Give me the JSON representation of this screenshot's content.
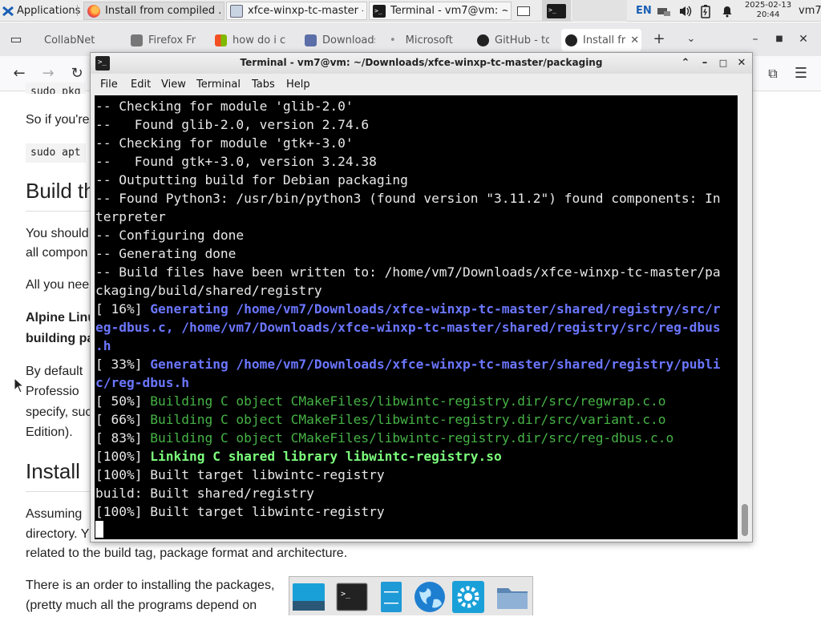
{
  "top_panel": {
    "applications_label": "Applications",
    "tasks": [
      {
        "label": "Install from compiled ...",
        "icon": "firefox-icon"
      },
      {
        "label": "xfce-winxp-tc-master -...",
        "icon": "folder-icon"
      },
      {
        "label": "Terminal - vm7@vm: ~...",
        "icon": "terminal-icon"
      }
    ],
    "keyboard_layout": "EN",
    "date": "2025-02-13",
    "time": "20:44",
    "user": "vm7"
  },
  "browser": {
    "tabs": [
      {
        "label": "CollabNet"
      },
      {
        "label": "Firefox Fr"
      },
      {
        "label": "how do i c"
      },
      {
        "label": "Downloads"
      },
      {
        "label": "Microsoft"
      },
      {
        "label": "GitHub - tc"
      },
      {
        "label": "Install fr"
      }
    ],
    "new_tab_symbol": "+",
    "page": {
      "cut_code": "sudo pkg",
      "p_if": "So if you're",
      "code_apt": "sudo apt",
      "h_build": "Build th",
      "p_should1": "You should",
      "p_should2": "all compon",
      "p_all": "All you nee",
      "p_alpine1": "Alpine Linu",
      "p_alpine2": "building pa",
      "p_default1": "By default",
      "p_default2": "Professio",
      "p_default3": "specify, suc",
      "p_default4": "Edition).",
      "h_install": "Install",
      "p_assuming": "Assuming",
      "p_directory": "directory. Y",
      "p_related": "related to the build tag, package format and architecture.",
      "p_order1": "There is an order to installing the packages,",
      "p_order2": "(pretty much all the programs depend on"
    }
  },
  "terminal": {
    "title": "Terminal - vm7@vm: ~/Downloads/xfce-winxp-tc-master/packaging",
    "menu": [
      "File",
      "Edit",
      "View",
      "Terminal",
      "Tabs",
      "Help"
    ],
    "lines": [
      {
        "parts": [
          {
            "t": "-- Checking for module 'glib-2.0'",
            "c": ""
          }
        ]
      },
      {
        "parts": [
          {
            "t": "--   Found glib-2.0, version 2.74.6",
            "c": ""
          }
        ]
      },
      {
        "parts": [
          {
            "t": "-- Checking for module 'gtk+-3.0'",
            "c": ""
          }
        ]
      },
      {
        "parts": [
          {
            "t": "--   Found gtk+-3.0, version 3.24.38",
            "c": ""
          }
        ]
      },
      {
        "parts": [
          {
            "t": "-- Outputting build for Debian packaging",
            "c": ""
          }
        ]
      },
      {
        "parts": [
          {
            "t": "-- Found Python3: /usr/bin/python3 (found version \"3.11.2\") found components: In",
            "c": ""
          }
        ]
      },
      {
        "parts": [
          {
            "t": "terpreter",
            "c": ""
          }
        ]
      },
      {
        "parts": [
          {
            "t": "-- Configuring done",
            "c": ""
          }
        ]
      },
      {
        "parts": [
          {
            "t": "-- Generating done",
            "c": ""
          }
        ]
      },
      {
        "parts": [
          {
            "t": "-- Build files have been written to: /home/vm7/Downloads/xfce-winxp-tc-master/pa",
            "c": ""
          }
        ]
      },
      {
        "parts": [
          {
            "t": "ckaging/build/shared/registry",
            "c": ""
          }
        ]
      },
      {
        "parts": [
          {
            "t": "[ 16%] ",
            "c": ""
          },
          {
            "t": "Generating /home/vm7/Downloads/xfce-winxp-tc-master/shared/registry/src/r",
            "c": "blue"
          }
        ]
      },
      {
        "parts": [
          {
            "t": "eg-dbus.c, /home/vm7/Downloads/xfce-winxp-tc-master/shared/registry/src/reg-dbus",
            "c": "blue"
          }
        ]
      },
      {
        "parts": [
          {
            "t": ".h",
            "c": "blue"
          }
        ]
      },
      {
        "parts": [
          {
            "t": "[ 33%] ",
            "c": ""
          },
          {
            "t": "Generating /home/vm7/Downloads/xfce-winxp-tc-master/shared/registry/publi",
            "c": "blue"
          }
        ]
      },
      {
        "parts": [
          {
            "t": "c/reg-dbus.h",
            "c": "blue"
          }
        ]
      },
      {
        "parts": [
          {
            "t": "[ 50%] ",
            "c": ""
          },
          {
            "t": "Building C object CMakeFiles/libwintc-registry.dir/src/regwrap.c.o",
            "c": "green"
          }
        ]
      },
      {
        "parts": [
          {
            "t": "[ 66%] ",
            "c": ""
          },
          {
            "t": "Building C object CMakeFiles/libwintc-registry.dir/src/variant.c.o",
            "c": "green"
          }
        ]
      },
      {
        "parts": [
          {
            "t": "[ 83%] ",
            "c": ""
          },
          {
            "t": "Building C object CMakeFiles/libwintc-registry.dir/src/reg-dbus.c.o",
            "c": "green"
          }
        ]
      },
      {
        "parts": [
          {
            "t": "[100%] ",
            "c": ""
          },
          {
            "t": "Linking C shared library libwintc-registry.so",
            "c": "bgreen"
          }
        ]
      },
      {
        "parts": [
          {
            "t": "[100%] Built target libwintc-registry",
            "c": ""
          }
        ]
      },
      {
        "parts": [
          {
            "t": "build: Built shared/registry",
            "c": ""
          }
        ]
      },
      {
        "parts": [
          {
            "t": "[100%] Built target libwintc-registry",
            "c": ""
          }
        ]
      }
    ]
  },
  "dock": {
    "items": [
      "desktop-icon",
      "terminal-icon",
      "file-manager-icon",
      "browser-icon",
      "settings-icon",
      "folder-icon"
    ]
  }
}
